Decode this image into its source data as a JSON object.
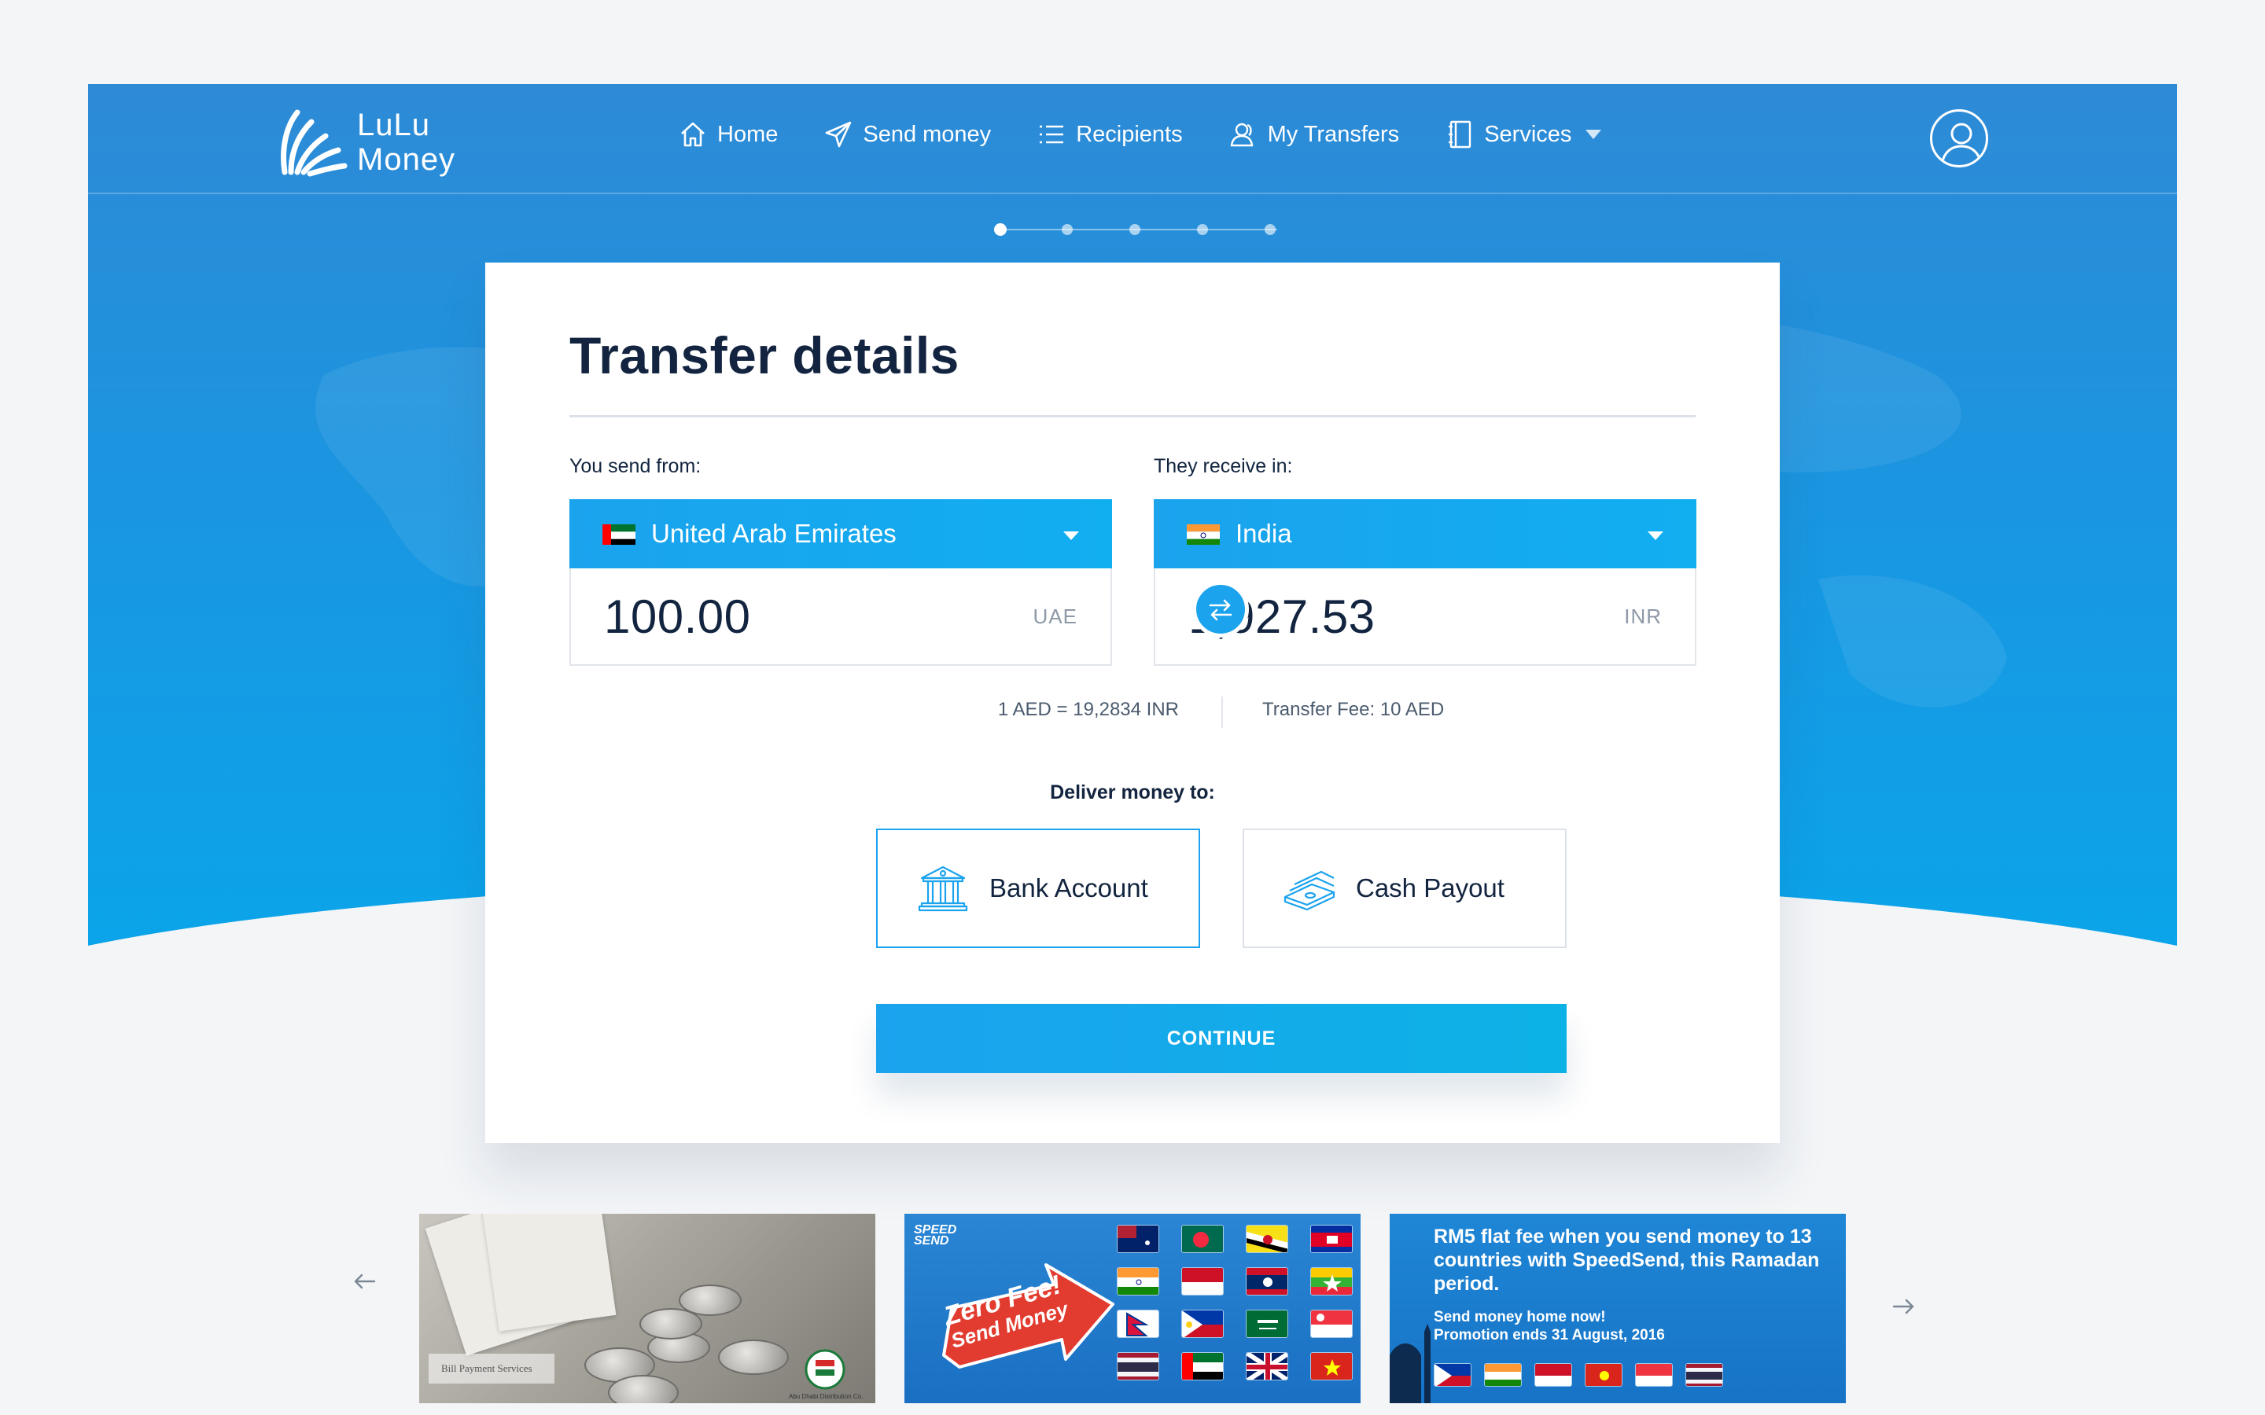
{
  "brand": {
    "logo_line1": "LuLu",
    "logo_line2": "Money"
  },
  "nav": {
    "home": "Home",
    "send_money": "Send money",
    "recipients": "Recipients",
    "my_transfers": "My Transfers",
    "services": "Services"
  },
  "steps": {
    "count": 5,
    "active_index": 0
  },
  "transfer": {
    "title": "Transfer details",
    "send_label": "You send from:",
    "receive_label": "They receive in:",
    "from_country": "United Arab Emirates",
    "to_country": "India",
    "send_amount": "100.00",
    "send_currency": "UAE",
    "receive_amount": "1,927.53",
    "receive_currency": "INR",
    "rate_text": "1 AED = 19,2834 INR",
    "fee_text": "Transfer Fee: 10 AED"
  },
  "deliver": {
    "label": "Deliver money to:",
    "bank_account": "Bank Account",
    "cash_payout": "Cash Payout",
    "selected": "bank_account"
  },
  "continue_label": "CONTINUE",
  "banners": {
    "bill_payment_label": "Bill Payment Services",
    "distribution_label": "Abu Dhabi Distribution Co.",
    "speed_logo_line1": "SPEED",
    "speed_logo_line2": "SEND",
    "zero_fee_line1": "Zero Fee!",
    "zero_fee_line2": "Send Money",
    "promo_headline": "RM5 flat fee when you send money to 13 countries with SpeedSend, this Ramadan period.",
    "promo_sub_line1": "Send money home now!",
    "promo_sub_line2": "Promotion ends 31 August, 2016"
  },
  "colors": {
    "primary": "#1ba3ee",
    "title_text": "#12243f",
    "hero_top": "#2e8ad6",
    "hero_bottom": "#0aa5ea"
  }
}
